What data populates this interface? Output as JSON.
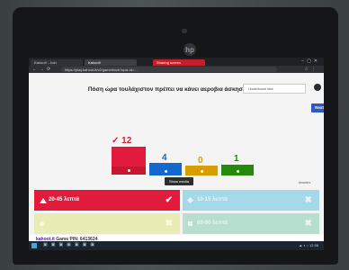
{
  "browser": {
    "tabs": [
      {
        "label": "Kahoot! - Join"
      },
      {
        "label": "Kahoot!"
      },
      {
        "label": "Sharing screen"
      }
    ],
    "url": "https://play.kahoot.it/v2/gameblock?quiz-id=..."
  },
  "kahoot": {
    "question": "Πόση ώρα τουλάχιστον πρέπει να κάνει αεροβια άσκηση;",
    "popup_text": "Leaderboard view",
    "next_label": "Next",
    "show_media_label": "Show media",
    "answers_meta": "Answers",
    "results": [
      {
        "count": "✓ 12",
        "color": "#e21b3c"
      },
      {
        "count": "4",
        "color": "#1368ce"
      },
      {
        "count": "0",
        "color": "#d89e00"
      },
      {
        "count": "1",
        "color": "#26890c"
      }
    ],
    "answers": [
      {
        "text": "20-45 λεπτά",
        "mark": "✔",
        "correct": true
      },
      {
        "text": "10-15 λεπτά",
        "mark": "✖",
        "correct": false
      },
      {
        "text": "",
        "mark": "✖",
        "correct": false
      },
      {
        "text": "60-90 λεπτά",
        "mark": "✖",
        "correct": false
      }
    ],
    "footer": {
      "logo": "kahoot.it",
      "pin_text": "Game PIN: 6413624"
    }
  },
  "brand_logo": "hp"
}
